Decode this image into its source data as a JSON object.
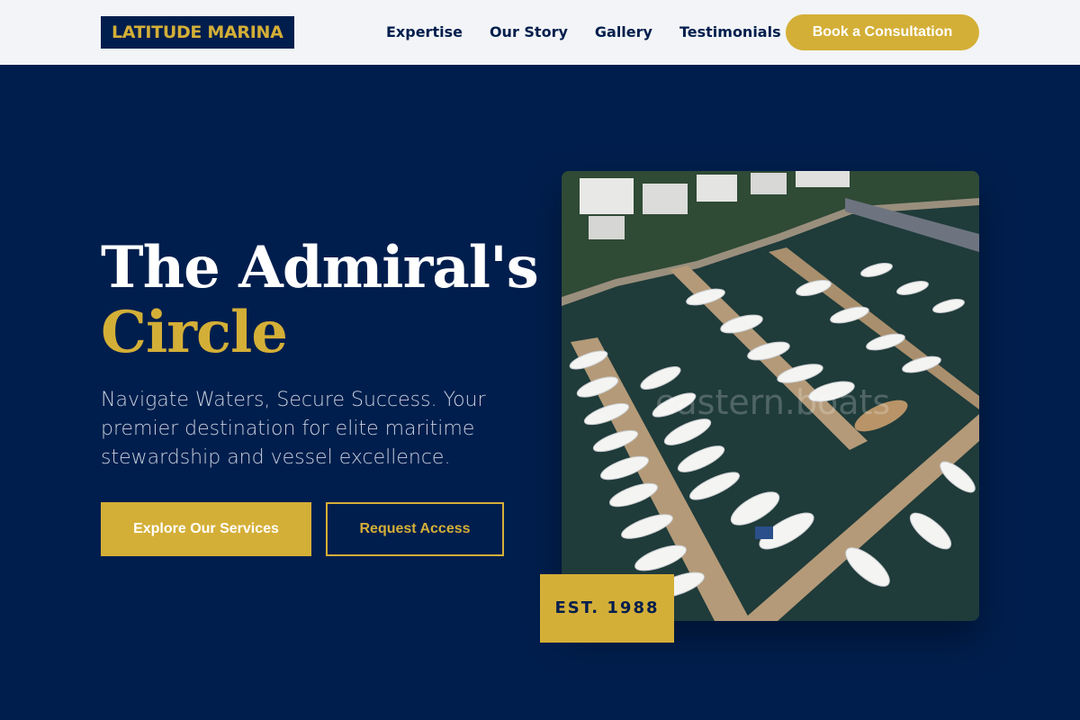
{
  "header": {
    "logo": "LATITUDE MARINA",
    "nav": [
      "Expertise",
      "Our Story",
      "Gallery",
      "Testimonials"
    ],
    "cta_label": "Book a Consultation"
  },
  "hero": {
    "title_line1": "The Admiral's",
    "title_line2": "Circle",
    "subtitle": "Navigate Waters, Secure Success. Your premier destination for elite maritime stewardship and vessel excellence.",
    "primary_button": "Explore Our Services",
    "secondary_button": "Request Access",
    "image_watermark": "eastern.boats",
    "badge": "EST. 1988"
  },
  "colors": {
    "navy": "#001e4d",
    "gold": "#d4af37",
    "header_bg": "#f2f4f7"
  }
}
